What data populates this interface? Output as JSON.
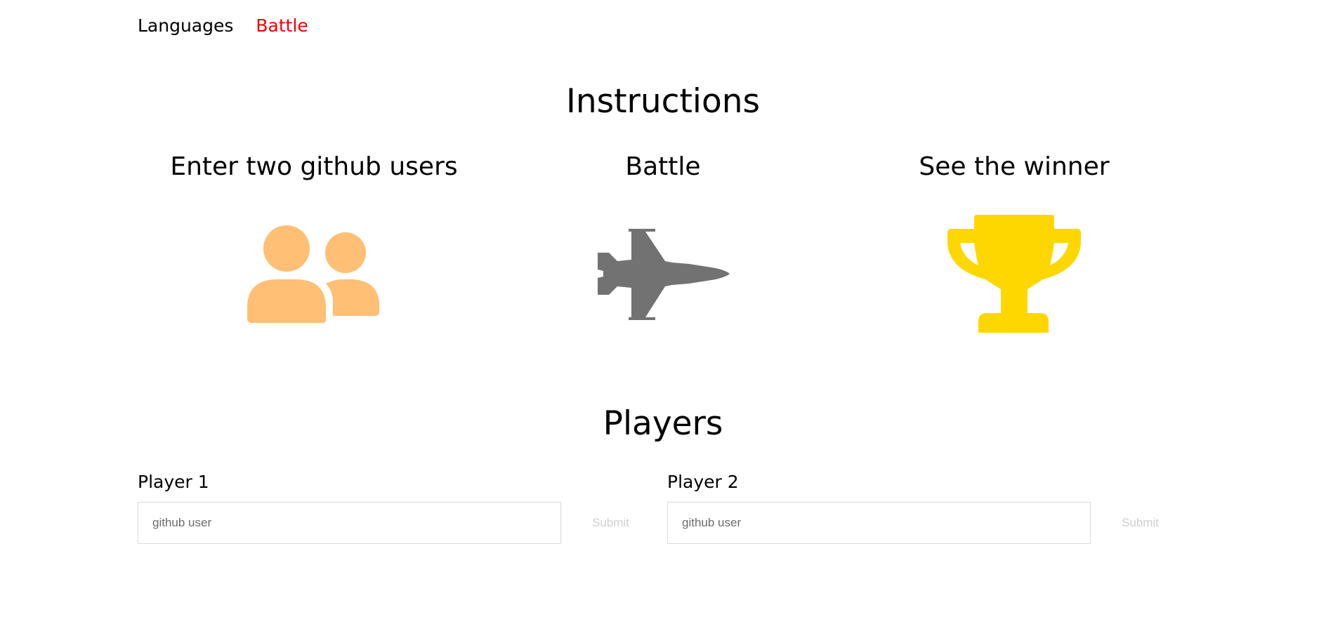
{
  "nav": {
    "items": [
      {
        "label": "Languages",
        "active": false
      },
      {
        "label": "Battle",
        "active": true
      }
    ],
    "active_color": "#ee0000"
  },
  "instructions": {
    "title": "Instructions",
    "steps": [
      {
        "title": "Enter two github users",
        "icon": "users-icon",
        "color": "#ffbf74"
      },
      {
        "title": "Battle",
        "icon": "fighter-jet-icon",
        "color": "#727272"
      },
      {
        "title": "See the winner",
        "icon": "trophy-icon",
        "color": "#ffd700"
      }
    ]
  },
  "players": {
    "title": "Players",
    "items": [
      {
        "label": "Player 1",
        "placeholder": "github user",
        "submit_label": "Submit"
      },
      {
        "label": "Player 2",
        "placeholder": "github user",
        "submit_label": "Submit"
      }
    ]
  }
}
